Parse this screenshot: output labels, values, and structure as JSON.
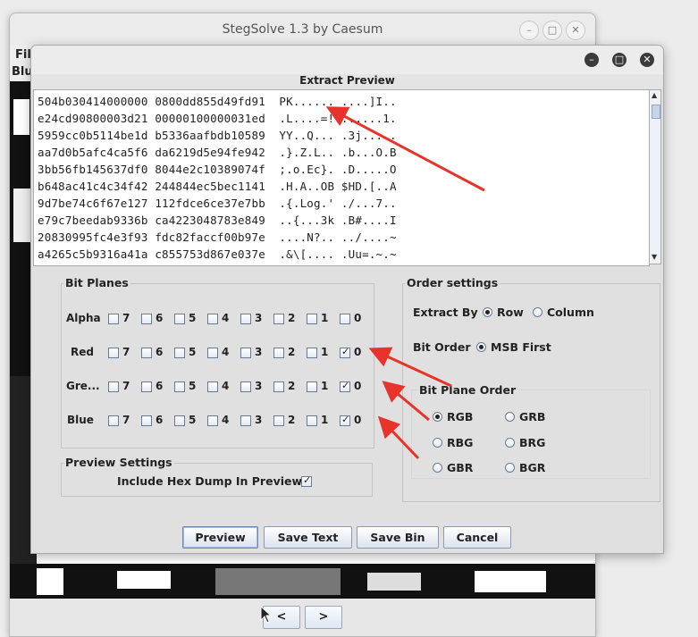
{
  "main_window": {
    "title": "StegSolve 1.3 by Caesum",
    "menu": {
      "file": "File",
      "blue_label": "Blue"
    },
    "prev_label": "<",
    "next_label": ">"
  },
  "dialog": {
    "title": "Extract Preview",
    "preview_lines": [
      "504b030414000000 0800dd855d49fd91  PK...... ....]I..",
      "e24cd90800003d21 00000100000031ed  .L....=!.......1.",
      "5959cc0b5114be1d b5336aafbdb10589  YY..Q... .3j.....",
      "aa7d0b5afc4ca5f6 da6219d5e94fe942  .}.Z.L.. .b...O.B",
      "3bb56fb145637df0 8044e2c10389074f  ;.o.Ec}. .D.....O",
      "b648ac41c4c34f42 244844ec5bec1141  .H.A..OB $HD.[..A",
      "9d7be74c6f67e127 112fdce6ce37e7bb  .{.Log.' ./...7..",
      "e79c7beedab9336b ca4223048783e849  ..{...3k .B#....I",
      "20830995fc4e3f93 fdc82faccf00b97e  ....N?.. ../....~",
      "a4265c5b9316a41a c855753d867e037e  .&\\[.... .Uu=.~.~"
    ],
    "bit_planes": {
      "title": "Bit Planes",
      "bits": [
        "7",
        "6",
        "5",
        "4",
        "3",
        "2",
        "1",
        "0"
      ],
      "rows": [
        {
          "label": "Alpha",
          "checked": []
        },
        {
          "label": "Red",
          "checked": [
            "0"
          ]
        },
        {
          "label": "Gre...",
          "checked": [
            "0"
          ]
        },
        {
          "label": "Blue",
          "checked": [
            "0"
          ]
        }
      ]
    },
    "preview_settings": {
      "title": "Preview Settings",
      "hex_dump_label": "Include Hex Dump In Preview",
      "hex_dump_checked": true
    },
    "order_settings": {
      "title": "Order settings",
      "extract_by_label": "Extract By",
      "extract_by_options": [
        "Row",
        "Column"
      ],
      "extract_by_selected": "Row",
      "bit_order_label": "Bit Order",
      "bit_order_option": "MSB First",
      "bit_plane_order_label": "Bit Plane Order",
      "bit_plane_order_options": [
        "RGB",
        "GRB",
        "RBG",
        "BRG",
        "GBR",
        "BGR"
      ],
      "bit_plane_order_selected": "RGB"
    },
    "buttons": {
      "preview": "Preview",
      "save_text": "Save Text",
      "save_bin": "Save Bin",
      "cancel": "Cancel"
    }
  },
  "colors": {
    "annotation_arrow": "#e8332a",
    "selected_focus": "#6f89b8"
  }
}
